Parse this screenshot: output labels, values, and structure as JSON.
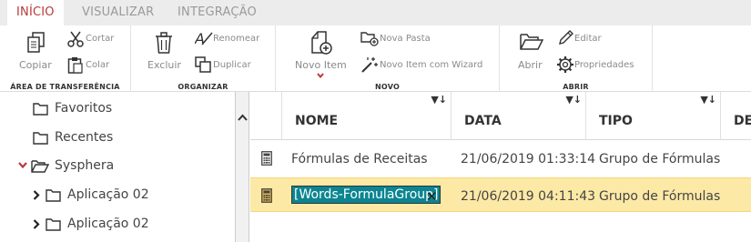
{
  "tabs": {
    "inicio": "INÍCIO",
    "visualizar": "VISUALIZAR",
    "integracao": "INTEGRAÇÃO"
  },
  "ribbon": {
    "clipboard": {
      "label": "ÁREA DE TRANSFERÊNCIA",
      "copiar": "Copiar",
      "cortar": "Cortar",
      "colar": "Colar"
    },
    "organizar": {
      "label": "ORGANIZAR",
      "excluir": "Excluir",
      "renomear": "Renomear",
      "duplicar": "Duplicar"
    },
    "novo": {
      "label": "NOVO",
      "novo_item": "Novo Item",
      "nova_pasta": "Nova Pasta",
      "novo_wizard": "Novo Item com Wizard"
    },
    "abrir": {
      "label": "ABRIR",
      "abrir": "Abrir",
      "editar": "Editar",
      "propriedades": "Propriedades"
    }
  },
  "tree": {
    "favoritos": "Favoritos",
    "recentes": "Recentes",
    "sysphera": "Sysphera",
    "app1": "Aplicação 02",
    "app2": "Aplicação 02"
  },
  "grid": {
    "columns": {
      "nome": "NOME",
      "data": "DATA",
      "tipo": "TIPO",
      "desc": "DES"
    },
    "filter_glyph": "▼↓",
    "rows": [
      {
        "nome": "Fórmulas de Receitas",
        "data": "21/06/2019 01:33:14",
        "tipo": "Grupo de Fórmulas"
      },
      {
        "nome": "[Words-FormulaGroup]",
        "data": "21/06/2019 04:11:43",
        "tipo": "Grupo de Fórmulas"
      }
    ],
    "cancel_glyph": "✕"
  },
  "colors": {
    "accent": "#b83a3a",
    "selected_row": "#fde9a6",
    "edit_bg": "#0b8591"
  }
}
